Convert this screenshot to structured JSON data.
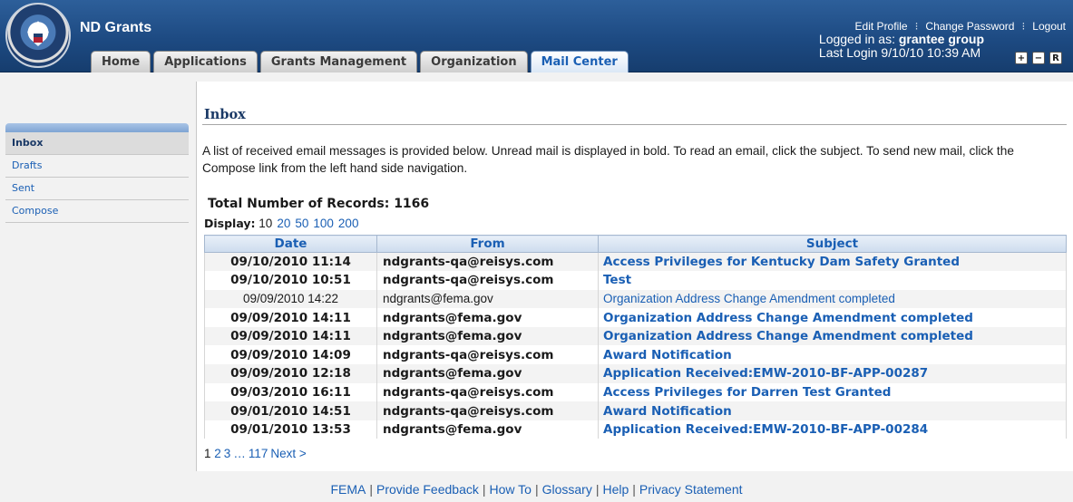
{
  "header": {
    "app_title": "ND Grants",
    "links": {
      "edit_profile": "Edit Profile",
      "change_password": "Change Password",
      "logout": "Logout"
    },
    "logged_in_label": "Logged in as:",
    "user_name": "grantee group",
    "last_login": "Last Login 9/10/10 10:39 AM",
    "font_controls": [
      "+",
      "−",
      "R"
    ],
    "seal_icon": "dhs-seal-icon"
  },
  "tabs": [
    {
      "label": "Home",
      "active": false
    },
    {
      "label": "Applications",
      "active": false
    },
    {
      "label": "Grants Management",
      "active": false
    },
    {
      "label": "Organization",
      "active": false
    },
    {
      "label": "Mail Center",
      "active": true
    }
  ],
  "sidebar": {
    "items": [
      {
        "label": "Inbox",
        "active": true
      },
      {
        "label": "Drafts",
        "active": false
      },
      {
        "label": "Sent",
        "active": false
      },
      {
        "label": "Compose",
        "active": false
      }
    ]
  },
  "main": {
    "title": "Inbox",
    "intro": "A list of received email messages is provided below. Unread mail is displayed in bold. To read an email, click the subject. To send new mail, click the Compose link from the left hand side navigation.",
    "total_records": "Total Number of Records: 1166",
    "display_label": "Display:",
    "display_options": [
      "10",
      "20",
      "50",
      "100",
      "200"
    ],
    "columns": {
      "date": "Date",
      "from": "From",
      "subject": "Subject"
    },
    "rows": [
      {
        "date": "09/10/2010 11:14",
        "from": "ndgrants-qa@reisys.com",
        "subject": "Access Privileges for Kentucky Dam Safety Granted",
        "unread": true
      },
      {
        "date": "09/10/2010 10:51",
        "from": "ndgrants-qa@reisys.com",
        "subject": "Test",
        "unread": true
      },
      {
        "date": "09/09/2010 14:22",
        "from": "ndgrants@fema.gov",
        "subject": "Organization Address Change Amendment completed",
        "unread": false
      },
      {
        "date": "09/09/2010 14:11",
        "from": "ndgrants@fema.gov",
        "subject": "Organization Address Change Amendment completed",
        "unread": true
      },
      {
        "date": "09/09/2010 14:11",
        "from": "ndgrants@fema.gov",
        "subject": "Organization Address Change Amendment completed",
        "unread": true
      },
      {
        "date": "09/09/2010 14:09",
        "from": "ndgrants-qa@reisys.com",
        "subject": "Award Notification",
        "unread": true
      },
      {
        "date": "09/09/2010 12:18",
        "from": "ndgrants@fema.gov",
        "subject": "Application Received:EMW-2010-BF-APP-00287",
        "unread": true
      },
      {
        "date": "09/03/2010 16:11",
        "from": "ndgrants-qa@reisys.com",
        "subject": "Access Privileges for Darren Test Granted",
        "unread": true
      },
      {
        "date": "09/01/2010 14:51",
        "from": "ndgrants-qa@reisys.com",
        "subject": "Award Notification",
        "unread": true
      },
      {
        "date": "09/01/2010 13:53",
        "from": "ndgrants@fema.gov",
        "subject": "Application Received:EMW-2010-BF-APP-00284",
        "unread": true
      }
    ],
    "pager": {
      "current": "1",
      "pages": [
        "2",
        "3"
      ],
      "ellipsis": "…",
      "last": "117",
      "next": "Next >"
    }
  },
  "footer": {
    "links": [
      "FEMA",
      "Provide Feedback",
      "How To",
      "Glossary",
      "Help",
      "Privacy Statement"
    ],
    "separator": "|"
  }
}
